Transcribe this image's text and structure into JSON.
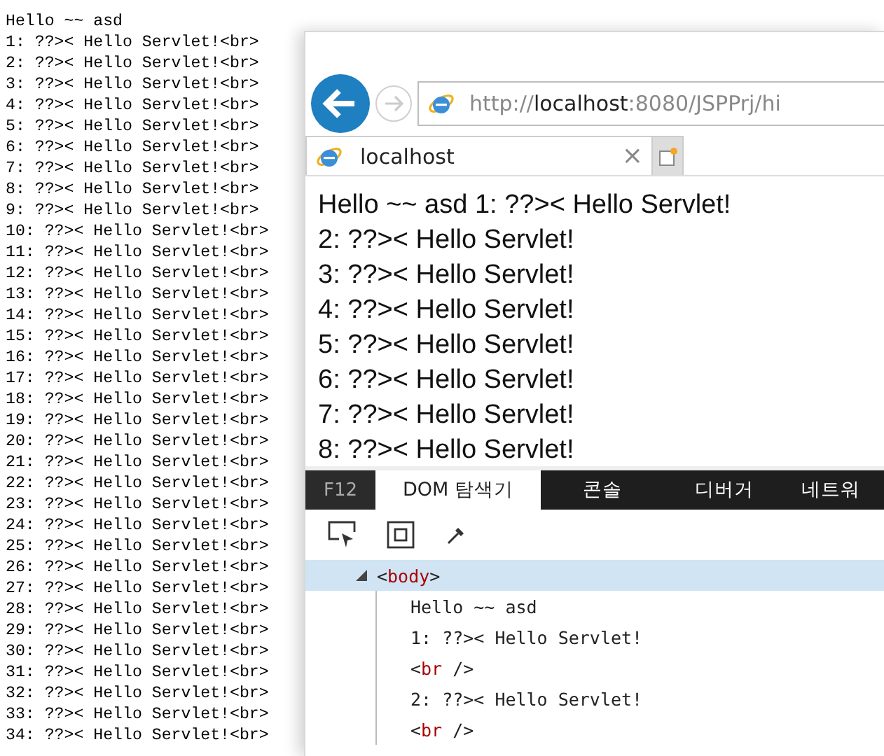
{
  "console_output": [
    "Hello ~~ asd",
    "1: ??>< Hello Servlet!<br>",
    "2: ??>< Hello Servlet!<br>",
    "3: ??>< Hello Servlet!<br>",
    "4: ??>< Hello Servlet!<br>",
    "5: ??>< Hello Servlet!<br>",
    "6: ??>< Hello Servlet!<br>",
    "7: ??>< Hello Servlet!<br>",
    "8: ??>< Hello Servlet!<br>",
    "9: ??>< Hello Servlet!<br>",
    "10: ??>< Hello Servlet!<br>",
    "11: ??>< Hello Servlet!<br>",
    "12: ??>< Hello Servlet!<br>",
    "13: ??>< Hello Servlet!<br>",
    "14: ??>< Hello Servlet!<br>",
    "15: ??>< Hello Servlet!<br>",
    "16: ??>< Hello Servlet!<br>",
    "17: ??>< Hello Servlet!<br>",
    "18: ??>< Hello Servlet!<br>",
    "19: ??>< Hello Servlet!<br>",
    "20: ??>< Hello Servlet!<br>",
    "21: ??>< Hello Servlet!<br>",
    "22: ??>< Hello Servlet!<br>",
    "23: ??>< Hello Servlet!<br>",
    "24: ??>< Hello Servlet!<br>",
    "25: ??>< Hello Servlet!<br>",
    "26: ??>< Hello Servlet!<br>",
    "27: ??>< Hello Servlet!<br>",
    "28: ??>< Hello Servlet!<br>",
    "29: ??>< Hello Servlet!<br>",
    "30: ??>< Hello Servlet!<br>",
    "31: ??>< Hello Servlet!<br>",
    "32: ??>< Hello Servlet!<br>",
    "33: ??>< Hello Servlet!<br>",
    "34: ??>< Hello Servlet!<br>"
  ],
  "browser": {
    "address": {
      "scheme": "http://",
      "host": "localhost",
      "path": ":8080/JSPPrj/hi"
    },
    "tabs": [
      {
        "label": "localhost",
        "close": "×",
        "selected": true
      }
    ],
    "page_lines": [
      "Hello ~~ asd 1: ??>< Hello Servlet!",
      "2: ??>< Hello Servlet!",
      "3: ??>< Hello Servlet!",
      "4: ??>< Hello Servlet!",
      "5: ??>< Hello Servlet!",
      "6: ??>< Hello Servlet!",
      "7: ??>< Hello Servlet!",
      "8: ??>< Hello Servlet!"
    ]
  },
  "devtools": {
    "f12_label": "F12",
    "tabs": [
      {
        "label": "DOM 탐색기",
        "selected": true
      },
      {
        "label": "콘솔",
        "selected": false
      },
      {
        "label": "디버거",
        "selected": false
      },
      {
        "label": "네트워",
        "selected": false
      }
    ],
    "tree": {
      "kind": "tag",
      "open": "<",
      "name": "body",
      "close": ">",
      "expanded": true,
      "selected": true,
      "children": [
        {
          "kind": "text",
          "text": "Hello ~~ asd"
        },
        {
          "kind": "text",
          "text": "1: ??>< Hello Servlet!"
        },
        {
          "kind": "tag",
          "open": "<",
          "name": "br",
          "close": " />"
        },
        {
          "kind": "text",
          "text": "2: ??>< Hello Servlet!"
        },
        {
          "kind": "tag",
          "open": "<",
          "name": "br",
          "close": " />"
        }
      ]
    }
  }
}
